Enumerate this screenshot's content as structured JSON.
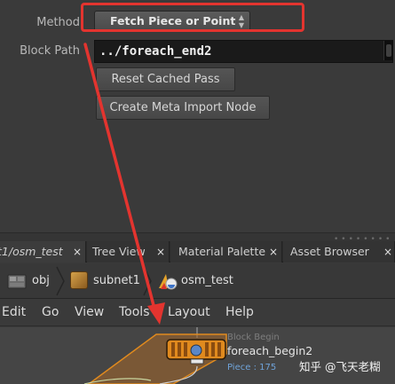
{
  "params": {
    "method_label": "Method",
    "method_value": "Fetch Piece or Point",
    "block_path_label": "Block Path",
    "block_path_value": "../foreach_end2",
    "reset_button": "Reset Cached Pass",
    "meta_button": "Create Meta Import Node"
  },
  "tabs": [
    {
      "label": "t1/osm_test",
      "close": "×"
    },
    {
      "label": "Tree View",
      "close": "×"
    },
    {
      "label": "Material Palette",
      "close": "×"
    },
    {
      "label": "Asset Browser",
      "close": "×"
    }
  ],
  "path": {
    "items": [
      {
        "label": "obj",
        "icon": "object-network-icon"
      },
      {
        "label": "subnet1",
        "icon": "subnet-icon"
      },
      {
        "label": "osm_test",
        "icon": "osm-node-icon"
      }
    ]
  },
  "menu": [
    "Edit",
    "Go",
    "View",
    "Tools",
    "Layout",
    "Help"
  ],
  "node": {
    "hint": "Block Begin",
    "name": "foreach_begin2",
    "piece": "Piece : 175"
  },
  "watermark": "知乎 @飞天老糊",
  "colors": {
    "highlight_red": "#e3342f",
    "node_orange": "#e08a1e",
    "piece_blue": "#6fa3d9"
  }
}
